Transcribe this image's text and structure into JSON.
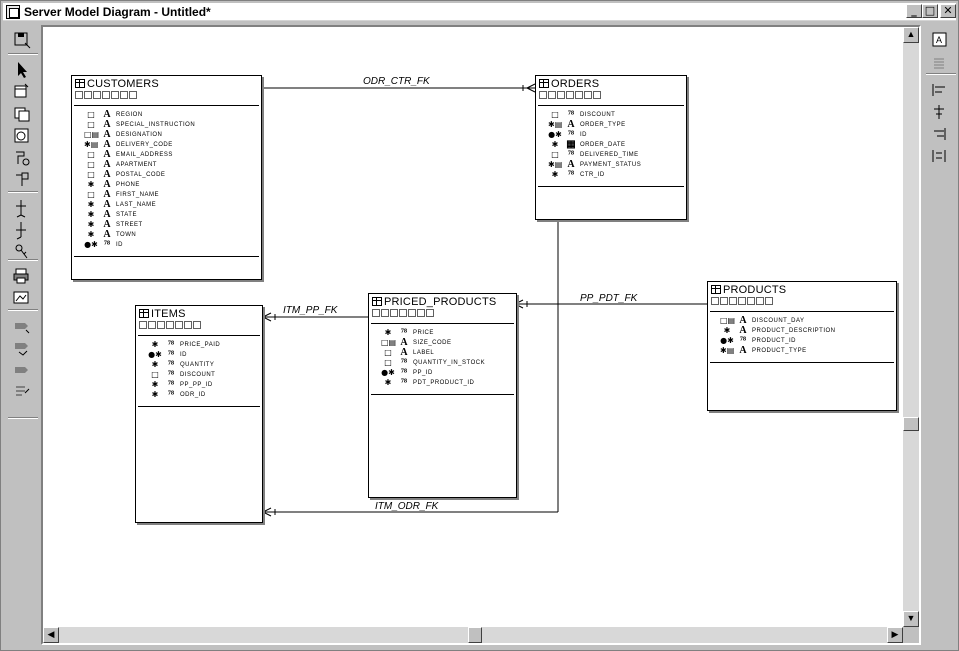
{
  "window": {
    "title": "Server Model Diagram - Untitled*"
  },
  "titlebar_buttons": {
    "minimize": "_",
    "maximize": "□",
    "close": "✕"
  },
  "left_toolbar": [
    "save-diagram-icon",
    "select-pointer-icon",
    "table-tool-icon",
    "view-tool-icon",
    "snapshot-tool-icon",
    "procedure-tool-icon",
    "cluster-tool-icon",
    "foreign-key-tool-icon",
    "recursive-key-tool-icon",
    "key-tool-icon",
    "print-icon",
    "zoom-icon",
    "fill-color-icon",
    "line-color-icon",
    "text-color-icon",
    "format-icon"
  ],
  "right_toolbar": [
    "display-toggle-icon",
    "sort-icon",
    "align-left-icon",
    "align-center-icon",
    "align-right-icon",
    "distribute-icon"
  ],
  "entities": [
    {
      "id": "customers",
      "name": "CUSTOMERS",
      "columns": [
        {
          "mark": "□",
          "type": "A",
          "name": "REGION"
        },
        {
          "mark": "□",
          "type": "A",
          "name": "SPECIAL_INSTRUCTION"
        },
        {
          "mark": "□▤",
          "type": "A",
          "name": "DESIGNATION"
        },
        {
          "mark": "✱▤",
          "type": "A",
          "name": "DELIVERY_CODE"
        },
        {
          "mark": "□",
          "type": "A",
          "name": "EMAIL_ADDRESS"
        },
        {
          "mark": "□",
          "type": "A",
          "name": "APARTMENT"
        },
        {
          "mark": "□",
          "type": "A",
          "name": "POSTAL_CODE"
        },
        {
          "mark": "✱",
          "type": "A",
          "name": "PHONE"
        },
        {
          "mark": "□",
          "type": "A",
          "name": "FIRST_NAME"
        },
        {
          "mark": "✱",
          "type": "A",
          "name": "LAST_NAME"
        },
        {
          "mark": "✱",
          "type": "A",
          "name": "STATE"
        },
        {
          "mark": "✱",
          "type": "A",
          "name": "STREET"
        },
        {
          "mark": "✱",
          "type": "A",
          "name": "TOWN"
        },
        {
          "mark": "●✱",
          "type": "⁷⁸",
          "name": "ID"
        }
      ]
    },
    {
      "id": "orders",
      "name": "ORDERS",
      "columns": [
        {
          "mark": "□",
          "type": "⁷⁸",
          "name": "DISCOUNT"
        },
        {
          "mark": "✱▤",
          "type": "A",
          "name": "ORDER_TYPE"
        },
        {
          "mark": "●✱",
          "type": "⁷⁸",
          "name": "ID"
        },
        {
          "mark": "✱",
          "type": "▦",
          "name": "ORDER_DATE"
        },
        {
          "mark": "□",
          "type": "⁷⁸",
          "name": "DELIVERED_TIME"
        },
        {
          "mark": "✱▤",
          "type": "A",
          "name": "PAYMENT_STATUS"
        },
        {
          "mark": "✱",
          "type": "⁷⁸",
          "name": "CTR_ID"
        }
      ]
    },
    {
      "id": "items",
      "name": "ITEMS",
      "columns": [
        {
          "mark": "✱",
          "type": "⁷⁸",
          "name": "PRICE_PAID"
        },
        {
          "mark": "●✱",
          "type": "⁷⁸",
          "name": "ID"
        },
        {
          "mark": "✱",
          "type": "⁷⁸",
          "name": "QUANTITY"
        },
        {
          "mark": "□",
          "type": "⁷⁸",
          "name": "DISCOUNT"
        },
        {
          "mark": "✱",
          "type": "⁷⁸",
          "name": "PP_PP_ID"
        },
        {
          "mark": "✱",
          "type": "⁷⁸",
          "name": "ODR_ID"
        }
      ]
    },
    {
      "id": "priced_products",
      "name": "PRICED_PRODUCTS",
      "columns": [
        {
          "mark": "✱",
          "type": "⁷⁸",
          "name": "PRICE"
        },
        {
          "mark": "□▤",
          "type": "A",
          "name": "SIZE_CODE"
        },
        {
          "mark": "□",
          "type": "A",
          "name": "LABEL"
        },
        {
          "mark": "□",
          "type": "⁷⁸",
          "name": "QUANTITY_IN_STOCK"
        },
        {
          "mark": "●✱",
          "type": "⁷⁸",
          "name": "PP_ID"
        },
        {
          "mark": "✱",
          "type": "⁷⁸",
          "name": "PDT_PRODUCT_ID"
        }
      ]
    },
    {
      "id": "products",
      "name": "PRODUCTS",
      "columns": [
        {
          "mark": "□▤",
          "type": "A",
          "name": "DISCOUNT_DAY"
        },
        {
          "mark": "✱",
          "type": "A",
          "name": "PRODUCT_DESCRIPTION"
        },
        {
          "mark": "●✱",
          "type": "⁷⁸",
          "name": "PRODUCT_ID"
        },
        {
          "mark": "✱▤",
          "type": "A",
          "name": "PRODUCT_TYPE"
        }
      ]
    }
  ],
  "relationships": [
    {
      "name": "ODR_CTR_FK"
    },
    {
      "name": "ITM_PP_FK"
    },
    {
      "name": "PP_PDT_FK"
    },
    {
      "name": "ITM_ODR_FK"
    }
  ]
}
